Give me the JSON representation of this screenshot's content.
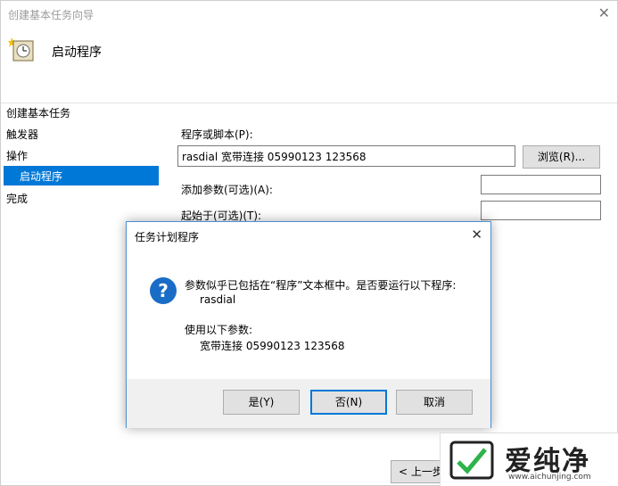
{
  "window": {
    "title": "创建基本任务向导",
    "close_glyph": "✕"
  },
  "header": {
    "title": "启动程序",
    "icon": "task-clock-icon"
  },
  "nav": {
    "section_title": "创建基本任务",
    "items": [
      "触发器",
      "操作",
      "启动程序",
      "完成"
    ],
    "selected": "启动程序"
  },
  "form": {
    "program_label": "程序或脚本(P):",
    "program_value": "rasdial 宽带连接 05990123 123568",
    "browse_label": "浏览(R)...",
    "args_label": "添加参数(可选)(A):",
    "args_value": "",
    "startin_label": "起始于(可选)(T):",
    "startin_value": ""
  },
  "dialog": {
    "title": "任务计划程序",
    "close_glyph": "✕",
    "icon": "question-icon",
    "message": "参数似乎已包括在“程序”文本框中。是否要运行以下程序:",
    "program": "rasdial",
    "params_label": "使用以下参数:",
    "params": "宽带连接 05990123 123568",
    "buttons": {
      "yes": "是(Y)",
      "no": "否(N)",
      "cancel": "取消"
    }
  },
  "footer": {
    "back_label": "< 上一步"
  },
  "watermark": {
    "text": "爱纯净",
    "url": "www.aichunjing.com"
  },
  "colors": {
    "accent": "#0078d7",
    "question_icon": "#1a6dc6",
    "dialog_border": "#4d8fd0"
  }
}
